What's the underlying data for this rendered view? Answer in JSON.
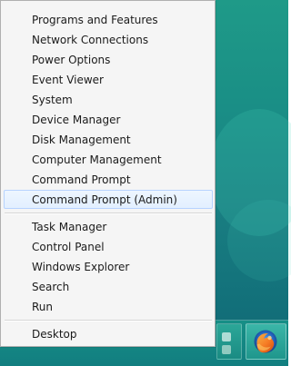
{
  "context_menu": {
    "items": [
      {
        "label": "Programs and Features"
      },
      {
        "label": "Network Connections"
      },
      {
        "label": "Power Options"
      },
      {
        "label": "Event Viewer"
      },
      {
        "label": "System"
      },
      {
        "label": "Device Manager"
      },
      {
        "label": "Disk Management"
      },
      {
        "label": "Computer Management"
      },
      {
        "label": "Command Prompt"
      },
      {
        "label": "Command Prompt (Admin)",
        "selected": true
      },
      {
        "label": "Task Manager"
      },
      {
        "label": "Control Panel"
      },
      {
        "label": "Windows Explorer"
      },
      {
        "label": "Search"
      },
      {
        "label": "Run"
      },
      {
        "label": "Desktop"
      }
    ]
  },
  "taskbar": {
    "pinned_icons": [
      "app-icon",
      "firefox-icon"
    ]
  },
  "colors": {
    "desktop_teal": "#1a8f86",
    "menu_background": "#f5f5f5",
    "menu_border": "#b0b0b0",
    "selection_border": "#b7d3ff",
    "selection_fill": "#e2efff",
    "text": "#1b1b1b"
  }
}
